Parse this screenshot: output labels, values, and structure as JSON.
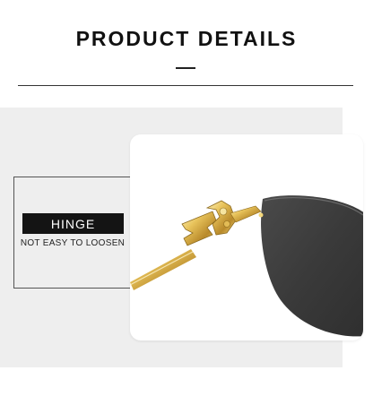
{
  "header": {
    "title": "PRODUCT DETAILS"
  },
  "feature": {
    "label": "HINGE",
    "description": "NOT EASY TO LOOSEN"
  },
  "colors": {
    "tag_background": "#141414",
    "panel_background": "#eeeeee",
    "gold": "#d9b24a",
    "lens": "#3c3c3c"
  },
  "image": {
    "subject": "sunglasses-hinge-closeup"
  }
}
